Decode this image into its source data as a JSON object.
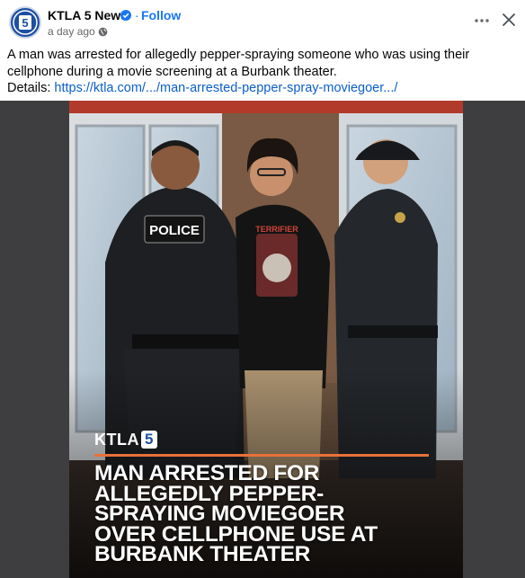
{
  "post": {
    "page_name": "KTLA 5 News",
    "follow_label": "Follow",
    "separator": "·",
    "time": "a day ago ·",
    "caption_text": "A man was arrested for allegedly pepper-spraying someone who was using their cellphone during a movie screening at a Burbank theater.",
    "details_label": "Details:",
    "details_link": "https://ktla.com/.../man-arrested-pepper-spray-moviegoer.../"
  },
  "image": {
    "logo_text": "KTLA",
    "logo_number": "5",
    "badge_text": "POLICE",
    "shirt_text": "TERRIFIER",
    "headline_lines": [
      "MAN ARRESTED FOR",
      "ALLEGEDLY PEPPER-",
      "SPRAYING MOVIEGOER",
      "OVER CELLPHONE USE AT",
      "BURBANK THEATER"
    ],
    "accent_color": "#e8713a"
  },
  "icons": {
    "avatar": "ktla-5-logo",
    "verified": "verified-badge-icon",
    "privacy": "globe-icon",
    "more": "more-options-icon",
    "close": "close-icon"
  },
  "colors": {
    "link": "#0b5fc9",
    "follow": "#1877f2",
    "secondary_text": "#65676b",
    "brand_blue": "#1d4fa3"
  }
}
